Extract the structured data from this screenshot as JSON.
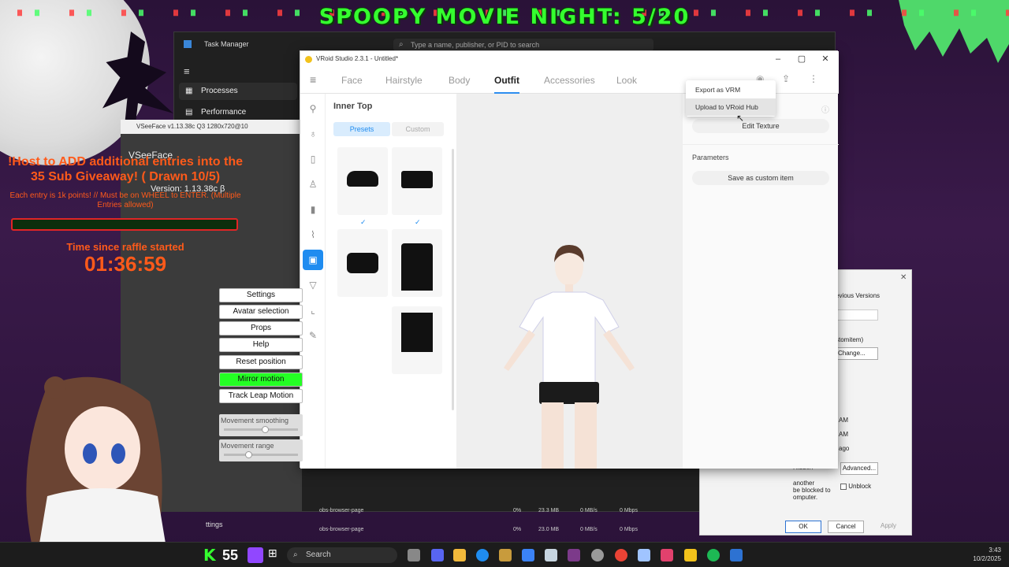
{
  "overlay": {
    "banner": "SPOOPY MOVIE NIGHT: 5/20",
    "raffle_title": "!Host to ADD additional entries into the 35 Sub Giveaway! ( Drawn 10/5)",
    "raffle_sub": "Each entry is 1k points! // Must be on WHEEL to ENTER. (Multiple Entries allowed)",
    "time_label": "Time since raffle started",
    "timer": "01:36:59",
    "sub_count": "55"
  },
  "task_manager": {
    "title": "Task Manager",
    "search_placeholder": "Type a name, publisher, or PID to search",
    "nav": [
      "Processes",
      "Performance"
    ],
    "rows": [
      {
        "name": "obs-browser-page",
        "cpu": "0%",
        "mem": "23.3 MB",
        "disk": "0 MB/s",
        "net": "0 Mbps"
      },
      {
        "name": "obs-browser-page",
        "cpu": "0%",
        "mem": "23.0 MB",
        "disk": "0 MB/s",
        "net": "0 Mbps"
      }
    ],
    "settings_label": "ttings"
  },
  "vseeface": {
    "titlebar": "VSeeFace v1.13.38c Q3 1280x720@10",
    "name": "VSeeFace",
    "version": "Version: 1.13.38c β",
    "buttons": [
      "Settings",
      "Avatar selection",
      "Props",
      "Help",
      "Reset position",
      "Mirror motion",
      "Track Leap Motion"
    ],
    "sliders": [
      {
        "label": "Movement smoothing",
        "value": 0.55
      },
      {
        "label": "Movement range",
        "value": 0.33
      }
    ]
  },
  "properties": {
    "tab": "evious Versions",
    "field1": "stomitem)",
    "change_button": "Change...",
    "am1": "AM",
    "am2": "AM",
    "ago": "ago",
    "hidden": "Hidden",
    "advanced_button": "Advanced...",
    "security1": "another",
    "security2": "be blocked to",
    "security3": "omputer.",
    "unblock": "Unblock",
    "ok": "OK",
    "cancel": "Cancel",
    "apply": "Apply",
    "size": "1280x720"
  },
  "vroid": {
    "title": "VRoid Studio 2.3.1 - Untitled*",
    "tabs": [
      "Face",
      "Hairstyle",
      "Body",
      "Outfit",
      "Accessories",
      "Look"
    ],
    "active_tab": "Outfit",
    "panel_title": "Inner Top",
    "segments": [
      "Presets",
      "Custom"
    ],
    "menu": [
      "Export as VRM",
      "Upload to VRoid Hub"
    ],
    "edit_texture": "Edit Texture",
    "parameters": "Parameters",
    "save_custom": "Save as custom item"
  },
  "taskbar": {
    "search": "Search",
    "time": "3:43",
    "date": "10/2/2025"
  },
  "colors": {
    "accent": "#1f8cf0",
    "banner": "#35ff2f",
    "raffle": "#ff5a1a",
    "mirror_active": "#24ff24"
  }
}
